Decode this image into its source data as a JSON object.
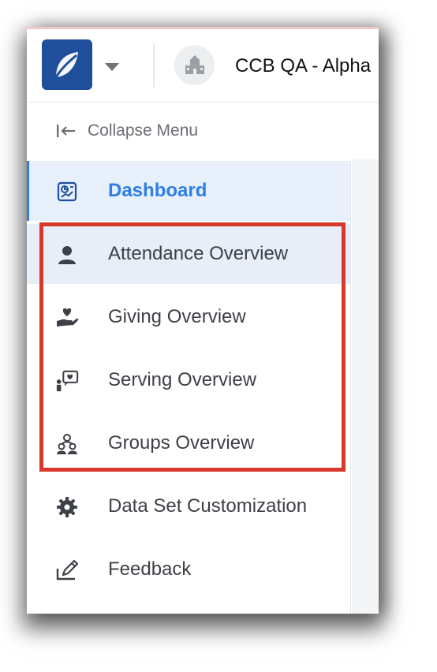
{
  "header": {
    "org_name": "CCB QA - Alpha"
  },
  "collapse": {
    "label": "Collapse Menu"
  },
  "menu": {
    "items": [
      {
        "label": "Dashboard",
        "icon": "dashboard-icon",
        "state": "active"
      },
      {
        "label": "Attendance Overview",
        "icon": "person-icon",
        "state": "hover"
      },
      {
        "label": "Giving Overview",
        "icon": "giving-hand-icon",
        "state": "normal"
      },
      {
        "label": "Serving Overview",
        "icon": "serving-icon",
        "state": "normal"
      },
      {
        "label": "Groups Overview",
        "icon": "groups-icon",
        "state": "normal"
      },
      {
        "label": "Data Set Customization",
        "icon": "gear-icon",
        "state": "normal"
      },
      {
        "label": "Feedback",
        "icon": "feedback-pen-icon",
        "state": "normal"
      }
    ]
  },
  "colors": {
    "accent": "#2f7ee6",
    "active_bg": "#e7f0fb",
    "highlight": "#d6392a",
    "logo_bg": "#1f4e9b"
  }
}
